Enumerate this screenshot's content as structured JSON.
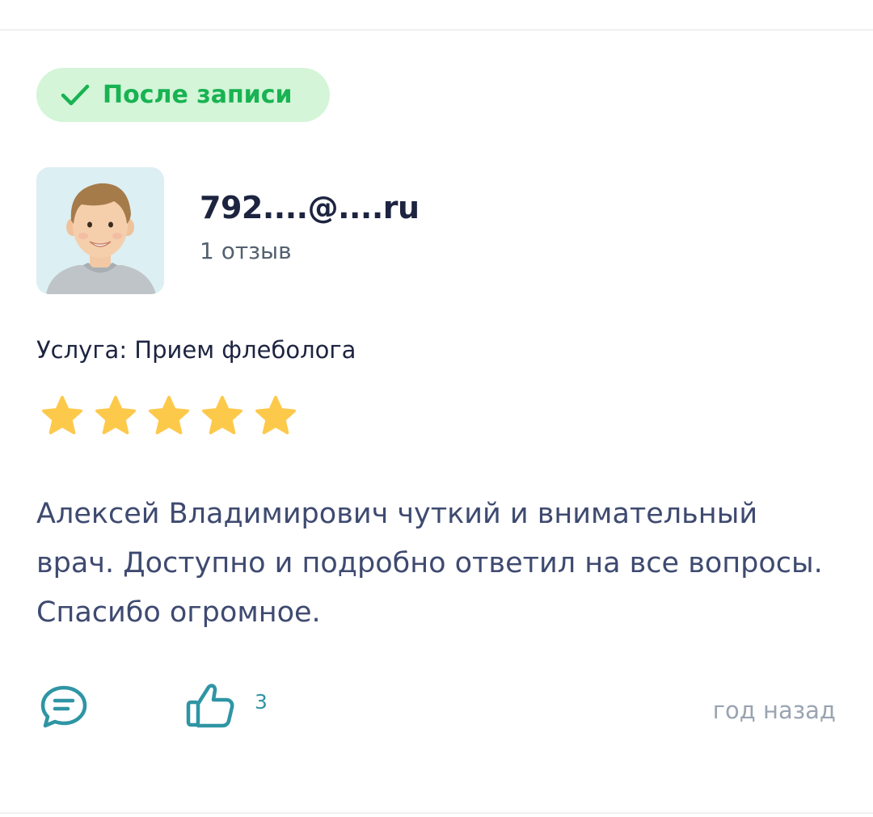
{
  "badge": {
    "label": "После записи",
    "icon": "check-icon",
    "color": "#18b352",
    "background": "#d4f5d8"
  },
  "author": {
    "name": "792....@....ru",
    "review_count": "1 отзыв",
    "avatar_icon": "user-avatar"
  },
  "service": {
    "text": "Услуга: Прием флеболога"
  },
  "rating": {
    "value": 5,
    "max": 5,
    "star_color": "#fdc94b"
  },
  "review": {
    "text": "Алексей Владимирович чуткий и внимательный врач. Доступно и подробно ответил на все вопросы. Спасибо огромное."
  },
  "actions": {
    "comment_icon": "comment-icon",
    "like_icon": "thumbs-up-icon",
    "like_count": "3",
    "accent_color": "#2f95a4"
  },
  "meta": {
    "time_ago": "год назад"
  }
}
